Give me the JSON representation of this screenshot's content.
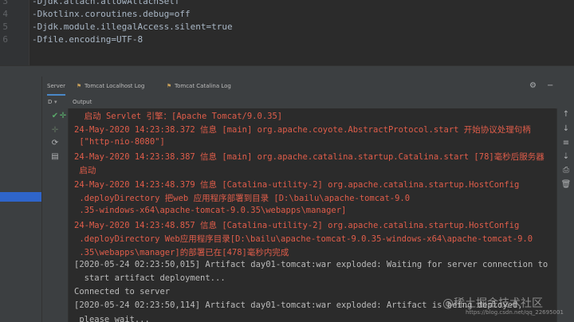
{
  "editor": {
    "line_numbers": [
      "3",
      "4",
      "5",
      "6"
    ],
    "lines": [
      "-Djdk.attach.allowAttachSelf",
      "-Dkotlinx.coroutines.debug=off",
      "-Djdk.module.illegalAccess.silent=true",
      "-Dfile.encoding=UTF-8"
    ]
  },
  "tabs": {
    "server": "Server",
    "localhost_log": "Tomcat Localhost Log",
    "catalina_log": "Tomcat Catalina Log"
  },
  "subbar": {
    "deploy_label": "D",
    "output_label": "Output"
  },
  "console": {
    "lines": [
      {
        "text": "  启动 Servlet 引擎：[Apache Tomcat/9.0.35]",
        "kind": "err"
      },
      {
        "text": "24-May-2020 14:23:38.372 信息 [main] org.apache.coyote.AbstractProtocol.start 开始协议处理句柄",
        "kind": "err"
      },
      {
        "text": " [\"http-nio-8080\"]",
        "kind": "err"
      },
      {
        "text": "24-May-2020 14:23:38.387 信息 [main] org.apache.catalina.startup.Catalina.start [78]毫秒后服务器",
        "kind": "err"
      },
      {
        "text": " 启动",
        "kind": "err"
      },
      {
        "text": "24-May-2020 14:23:48.379 信息 [Catalina-utility-2] org.apache.catalina.startup.HostConfig",
        "kind": "err"
      },
      {
        "text": " .deployDirectory 把web 应用程序部署到目录 [D:\\bailu\\apache-tomcat-9.0",
        "kind": "err"
      },
      {
        "text": " .35-windows-x64\\apache-tomcat-9.0.35\\webapps\\manager]",
        "kind": "err"
      },
      {
        "text": "24-May-2020 14:23:48.857 信息 [Catalina-utility-2] org.apache.catalina.startup.HostConfig",
        "kind": "err"
      },
      {
        "text": " .deployDirectory Web应用程序目录[D:\\bailu\\apache-tomcat-9.0.35-windows-x64\\apache-tomcat-9.0",
        "kind": "err"
      },
      {
        "text": " .35\\webapps\\manager]的部署已在[478]毫秒内完成",
        "kind": "err"
      },
      {
        "text": "[2020-05-24 02:23:50,015] Artifact day01-tomcat:war exploded: Waiting for server connection to",
        "kind": "norm"
      },
      {
        "text": "  start artifact deployment...",
        "kind": "norm"
      },
      {
        "text": "Connected to server",
        "kind": "norm"
      },
      {
        "text": "[2020-05-24 02:23:50,114] Artifact day01-tomcat:war exploded: Artifact is being deployed,",
        "kind": "norm"
      },
      {
        "text": " please wait...",
        "kind": "norm"
      }
    ]
  },
  "watermark": {
    "main": "@稀土掘金技术社区",
    "sub": "https://blog.csdn.net/qq_22695001"
  },
  "colors": {
    "error_text": "#e05d4a",
    "normal_text": "#bbbbbb",
    "accent": "#4a88c7",
    "run_green": "#59a869"
  }
}
